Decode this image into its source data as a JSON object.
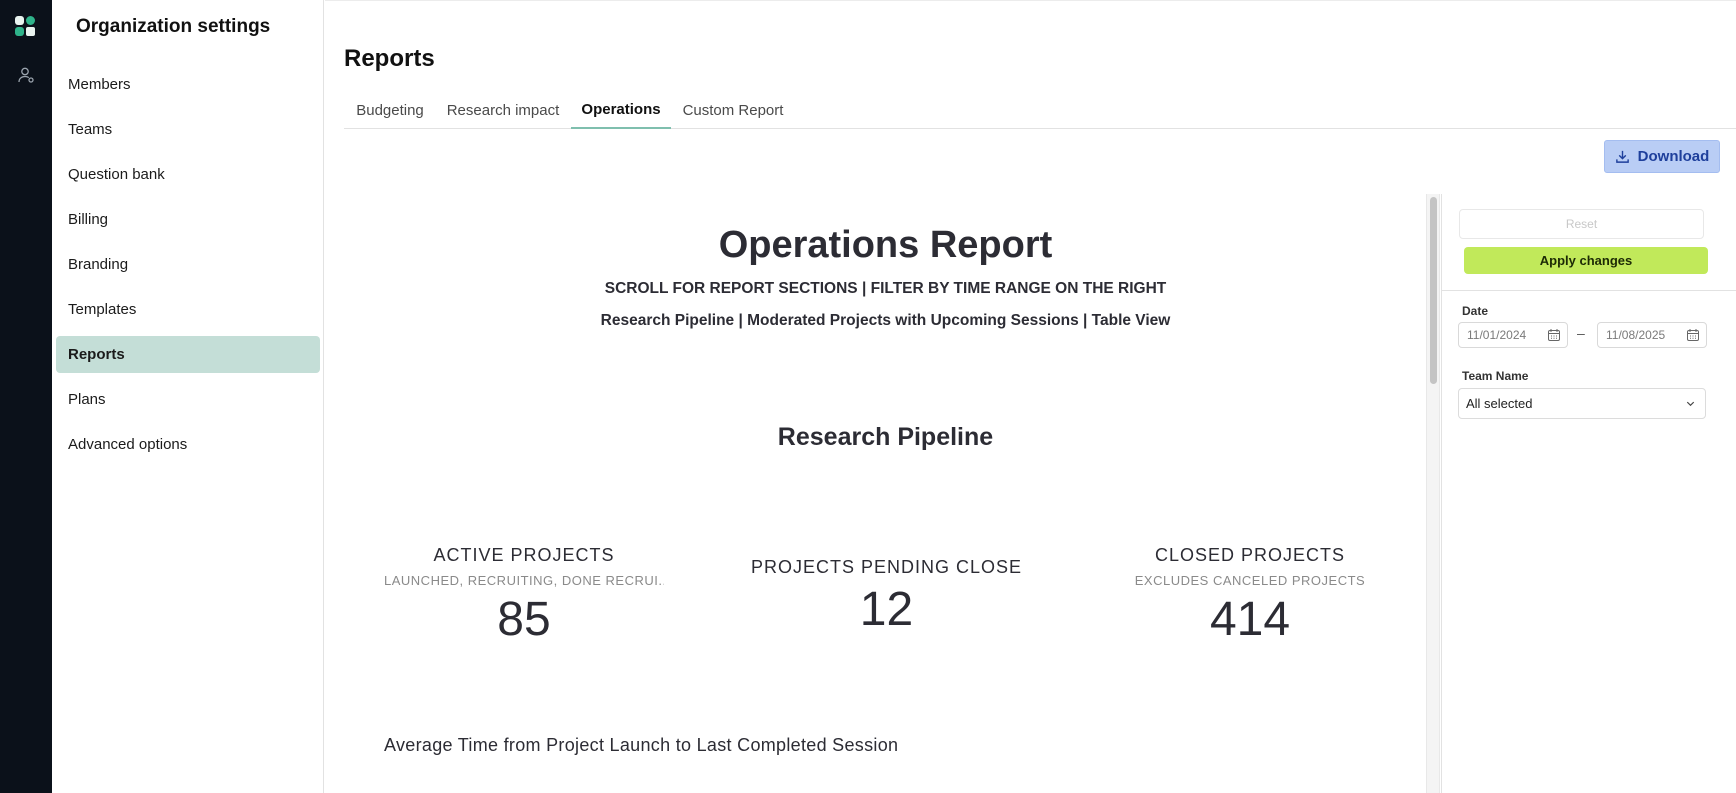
{
  "app": {
    "rail": {
      "logo_icon": "app-logo-icon",
      "people_icon": "person-icon"
    }
  },
  "sidebar": {
    "title": "Organization settings",
    "items": [
      {
        "label": "Members",
        "active": false
      },
      {
        "label": "Teams",
        "active": false
      },
      {
        "label": "Question bank",
        "active": false
      },
      {
        "label": "Billing",
        "active": false
      },
      {
        "label": "Branding",
        "active": false
      },
      {
        "label": "Templates",
        "active": false
      },
      {
        "label": "Reports",
        "active": true
      },
      {
        "label": "Plans",
        "active": false
      },
      {
        "label": "Advanced options",
        "active": false
      }
    ],
    "active_color": "#c4ded7"
  },
  "main": {
    "title": "Reports",
    "tabs": [
      {
        "label": "Budgeting",
        "active": false
      },
      {
        "label": "Research impact",
        "active": false
      },
      {
        "label": "Operations",
        "active": true
      },
      {
        "label": "Custom Report",
        "active": false
      }
    ],
    "download_label": "Download",
    "accent_color": "#7fbfae"
  },
  "report": {
    "title": "Operations Report",
    "subtitle1": "SCROLL FOR REPORT SECTIONS | FILTER BY TIME RANGE ON THE RIGHT",
    "subtitle2": "Research Pipeline | Moderated Projects with Upcoming Sessions | Table View",
    "section_title": "Research Pipeline",
    "kpis": [
      {
        "label": "ACTIVE PROJECTS",
        "sub": "LAUNCHED, RECRUITING, DONE RECRUI...",
        "value": "85"
      },
      {
        "label": "PROJECTS PENDING CLOSE",
        "sub": "",
        "value": "12"
      },
      {
        "label": "CLOSED PROJECTS",
        "sub": "EXCLUDES CANCELED PROJECTS",
        "value": "414"
      }
    ],
    "next_section_title": "Average Time from Project Launch to Last Completed Session"
  },
  "filters": {
    "reset_label": "Reset",
    "apply_label": "Apply changes",
    "apply_color": "#c1e95a",
    "date_label": "Date",
    "date_from": "11/01/2024",
    "date_to": "11/08/2025",
    "date_separator": "–",
    "team_label": "Team Name",
    "team_value": "All selected"
  }
}
